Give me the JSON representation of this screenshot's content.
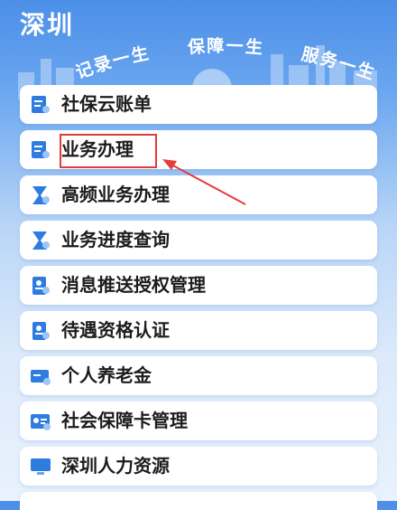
{
  "header": {
    "city": "深圳",
    "slogan": [
      "记录一生",
      "保障一生",
      "服务一生"
    ]
  },
  "menu": [
    {
      "label": "社保云账单",
      "icon": "bill-icon"
    },
    {
      "label": "业务办理",
      "icon": "business-icon"
    },
    {
      "label": "高频业务办理",
      "icon": "hourglass-icon"
    },
    {
      "label": "业务进度查询",
      "icon": "hourglass-search-icon"
    },
    {
      "label": "消息推送授权管理",
      "icon": "message-auth-icon"
    },
    {
      "label": "待遇资格认证",
      "icon": "certification-icon"
    },
    {
      "label": "个人养老金",
      "icon": "pension-card-icon"
    },
    {
      "label": "社会保障卡管理",
      "icon": "id-card-icon"
    },
    {
      "label": "深圳人力资源",
      "icon": "monitor-icon"
    }
  ],
  "colors": {
    "primary": "#2f7ce0",
    "highlight": "#e43c38"
  }
}
